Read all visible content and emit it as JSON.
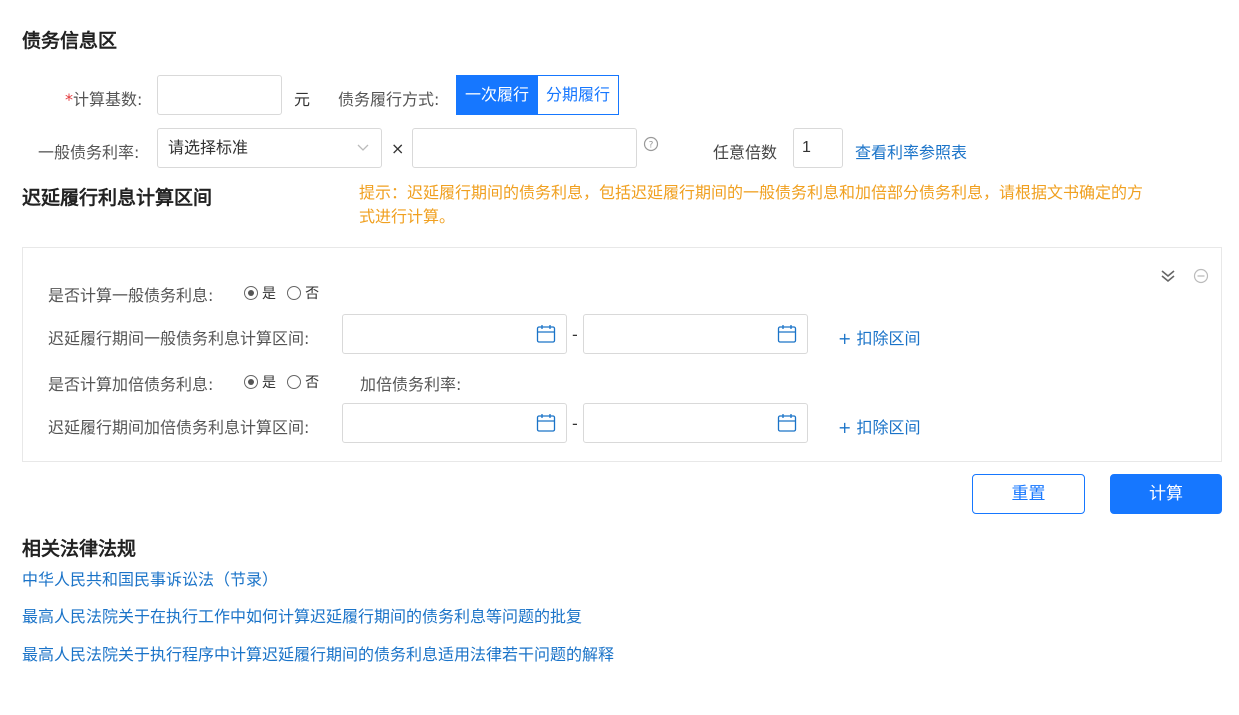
{
  "debt_section": {
    "title": "债务信息区",
    "base_amount": {
      "required_mark": "*",
      "label": "计算基数:",
      "value": "",
      "unit": "元"
    },
    "method": {
      "label": "债务履行方式:",
      "options": [
        "一次履行",
        "分期履行"
      ],
      "selected": "一次履行"
    },
    "rate": {
      "label": "一般债务利率:",
      "select_placeholder": "请选择标准",
      "multiply": "×",
      "value": "",
      "multiple_label": "任意倍数",
      "multiple_value": "1",
      "reference_link": "查看利率参照表"
    }
  },
  "delay_section": {
    "title": "迟延履行利息计算区间",
    "hint_line1": "提示：迟延履行期间的债务利息，包括迟延履行期间的一般债务利息和加倍部分债务利息，请根据文书确定的方",
    "hint_line2": "式进行计算。",
    "general_interest": {
      "label": "是否计算一般债务利息:",
      "yes": "是",
      "no": "否",
      "selected": "是"
    },
    "general_interval": {
      "label": "迟延履行期间一般债务利息计算区间:",
      "separator": "-",
      "deduct_link": "+ 扣除区间"
    },
    "double_interest": {
      "label": "是否计算加倍债务利息:",
      "yes": "是",
      "no": "否",
      "selected": "是",
      "rate_label": "加倍债务利率:"
    },
    "double_interval": {
      "label": "迟延履行期间加倍债务利息计算区间:",
      "separator": "-",
      "deduct_link": "+ 扣除区间"
    }
  },
  "actions": {
    "reset": "重置",
    "calculate": "计算"
  },
  "laws": {
    "title": "相关法律法规",
    "items": [
      "中华人民共和国民事诉讼法（节录）",
      "最高人民法院关于在执行工作中如何计算迟延履行期间的债务利息等问题的批复",
      "最高人民法院关于执行程序中计算迟延履行期间的债务利息适用法律若干问题的解释"
    ]
  },
  "colors": {
    "primary": "#1677ff",
    "link": "#1a73c8",
    "hint": "#f0a020",
    "required": "#e4393c"
  }
}
